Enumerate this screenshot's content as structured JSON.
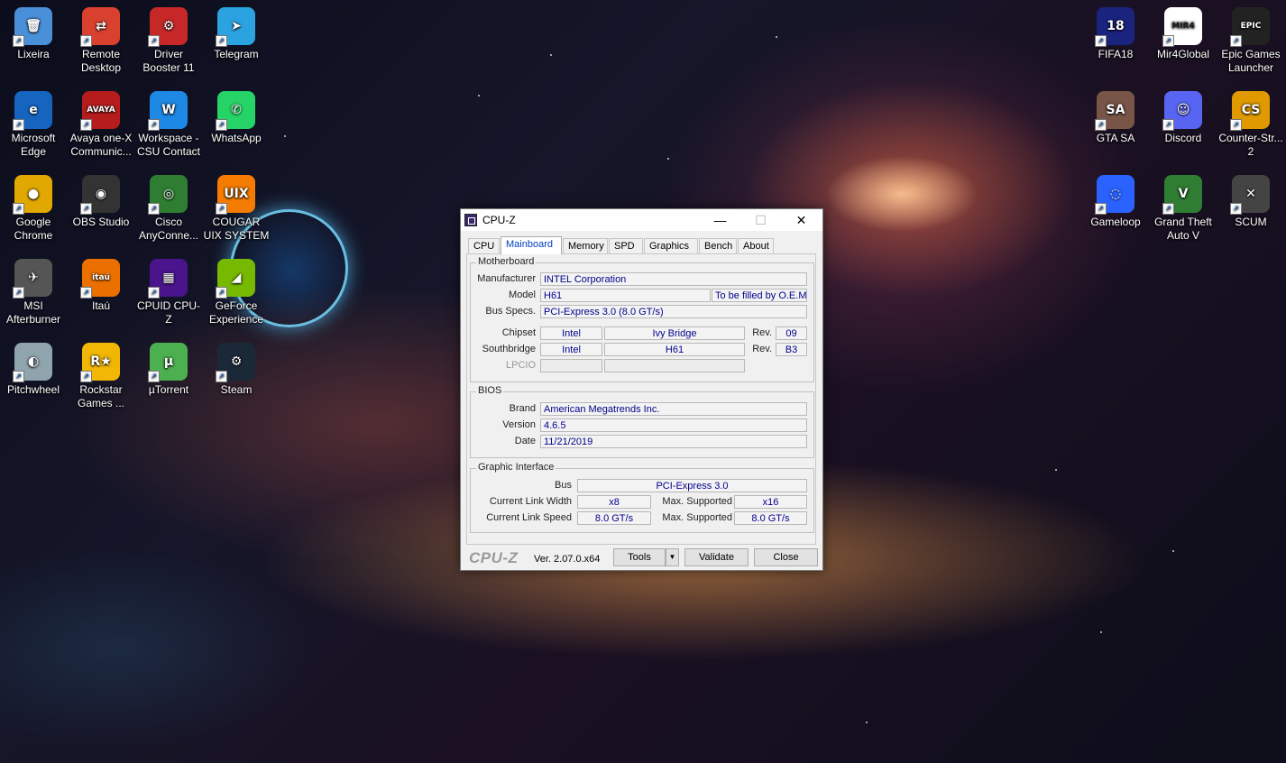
{
  "desktop": {
    "icons_left": [
      {
        "label": "Lixeira",
        "icon": "recycle-bin-icon"
      },
      {
        "label": "Remote Desktop",
        "icon": "remote-desktop-icon"
      },
      {
        "label": "Driver Booster 11",
        "icon": "driver-booster-icon"
      },
      {
        "label": "Telegram",
        "icon": "telegram-icon"
      },
      {
        "label": "Microsoft Edge",
        "icon": "edge-icon"
      },
      {
        "label": "Avaya one-X Communic...",
        "icon": "avaya-icon"
      },
      {
        "label": "Workspace - CSU Contact",
        "icon": "workspace-icon"
      },
      {
        "label": "WhatsApp",
        "icon": "whatsapp-icon"
      },
      {
        "label": "Google Chrome",
        "icon": "chrome-icon"
      },
      {
        "label": "OBS Studio",
        "icon": "obs-icon"
      },
      {
        "label": "Cisco AnyConne...",
        "icon": "cisco-icon"
      },
      {
        "label": "COUGAR UIX SYSTEM",
        "icon": "cougar-icon"
      },
      {
        "label": "MSI Afterburner",
        "icon": "msi-afterburner-icon"
      },
      {
        "label": "Itaú",
        "icon": "itau-icon"
      },
      {
        "label": "CPUID CPU-Z",
        "icon": "cpuz-icon"
      },
      {
        "label": "GeForce Experience",
        "icon": "geforce-icon"
      },
      {
        "label": "Pitchwheel",
        "icon": "pitchwheel-icon"
      },
      {
        "label": "Rockstar Games ...",
        "icon": "rockstar-icon"
      },
      {
        "label": "µTorrent",
        "icon": "utorrent-icon"
      },
      {
        "label": "Steam",
        "icon": "steam-icon"
      }
    ],
    "icons_right": [
      {
        "label": "FIFA18",
        "icon": "fifa18-icon"
      },
      {
        "label": "Mir4Global",
        "icon": "mir4-icon"
      },
      {
        "label": "Epic Games Launcher",
        "icon": "epic-games-icon"
      },
      {
        "label": "GTA SA",
        "icon": "gta-sa-icon"
      },
      {
        "label": "Discord",
        "icon": "discord-icon"
      },
      {
        "label": "Counter-Str... 2",
        "icon": "counter-strike-icon"
      },
      {
        "label": "Gameloop",
        "icon": "gameloop-icon"
      },
      {
        "label": "Grand Theft Auto V",
        "icon": "gta-v-icon"
      },
      {
        "label": "SCUM",
        "icon": "scum-icon"
      }
    ],
    "icon_glyphs": {
      "Remote Desktop": "⇄",
      "Driver Booster 11": "⚙",
      "Telegram": "➤",
      "Microsoft Edge": "e",
      "Avaya one-X Communic...": "AVAYA",
      "Workspace - CSU Contact": "W",
      "WhatsApp": "✆",
      "Google Chrome": "●",
      "OBS Studio": "◉",
      "Cisco AnyConne...": "◎",
      "COUGAR UIX SYSTEM": "UIX",
      "MSI Afterburner": "✈",
      "Itaú": "itaú",
      "CPUID CPU-Z": "▦",
      "GeForce Experience": "◢",
      "Pitchwheel": "◐",
      "Rockstar Games ...": "R★",
      "µTorrent": "µ",
      "Steam": "⚙",
      "FIFA18": "18",
      "Mir4Global": "MIR4",
      "Epic Games Launcher": "EPIC",
      "GTA SA": "SA",
      "Discord": "☺",
      "Counter-Str... 2": "CS",
      "Gameloop": "◌",
      "Grand Theft Auto V": "V",
      "SCUM": "✕",
      "Lixeira": "🗑"
    }
  },
  "cpuz": {
    "title": "CPU-Z",
    "controls": {
      "minimize": "—",
      "maximize": "☐",
      "close": "✕"
    },
    "tabs": [
      "CPU",
      "Mainboard",
      "Memory",
      "SPD",
      "Graphics",
      "Bench",
      "About"
    ],
    "active_tab": "Mainboard",
    "motherboard": {
      "group_label": "Motherboard",
      "manufacturer_label": "Manufacturer",
      "manufacturer": "INTEL Corporation",
      "model_label": "Model",
      "model": "H61",
      "model_extra": "To be filled by O.E.M.",
      "bus_label": "Bus Specs.",
      "bus": "PCI-Express 3.0 (8.0 GT/s)",
      "chipset_label": "Chipset",
      "chipset_vendor": "Intel",
      "chipset_name": "Ivy Bridge",
      "rev_label": "Rev.",
      "chipset_rev": "09",
      "southbridge_label": "Southbridge",
      "southbridge_vendor": "Intel",
      "southbridge_name": "H61",
      "southbridge_rev": "B3",
      "lpcio_label": "LPCIO"
    },
    "bios": {
      "group_label": "BIOS",
      "brand_label": "Brand",
      "brand": "American Megatrends Inc.",
      "version_label": "Version",
      "version": "4.6.5",
      "date_label": "Date",
      "date": "11/21/2019"
    },
    "graphic_interface": {
      "group_label": "Graphic Interface",
      "bus_label": "Bus",
      "bus": "PCI-Express 3.0",
      "link_width_label": "Current Link Width",
      "link_width": "x8",
      "max_supported_label": "Max. Supported",
      "max_width": "x16",
      "link_speed_label": "Current Link Speed",
      "link_speed": "8.0 GT/s",
      "max_speed": "8.0 GT/s"
    },
    "footer": {
      "logo": "CPU-Z",
      "version": "Ver. 2.07.0.x64",
      "tools": "Tools",
      "validate": "Validate",
      "close": "Close"
    }
  }
}
